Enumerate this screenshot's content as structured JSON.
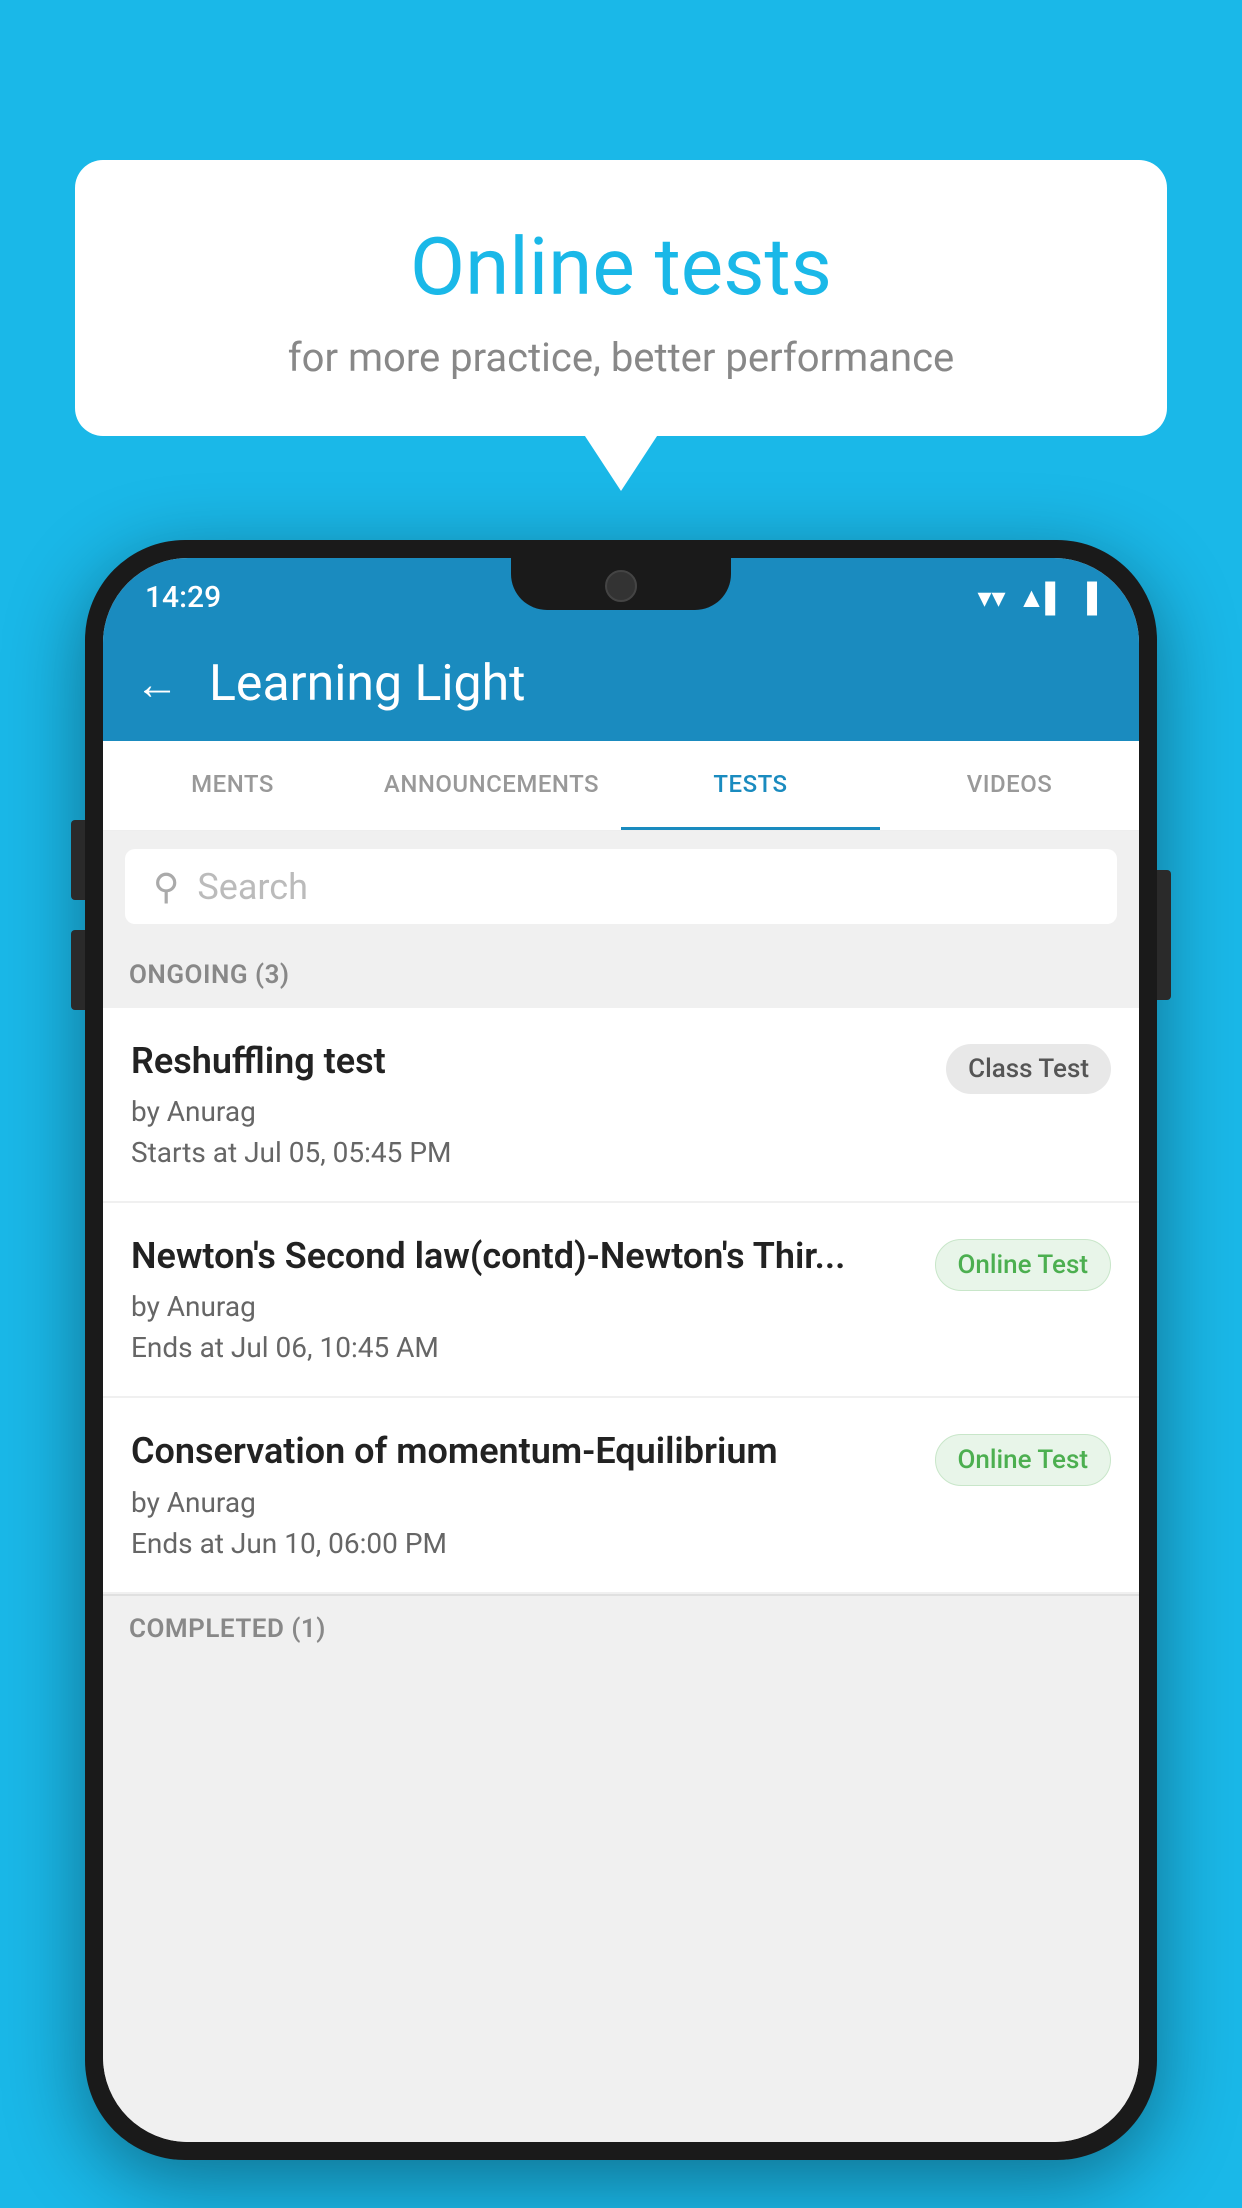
{
  "background": {
    "color": "#1ab8e8"
  },
  "speech_bubble": {
    "title": "Online tests",
    "subtitle": "for more practice, better performance"
  },
  "phone": {
    "status_bar": {
      "time": "14:29",
      "wifi": "▼",
      "signal": "▲",
      "battery": "▐"
    },
    "app_bar": {
      "back_label": "←",
      "title": "Learning Light"
    },
    "tabs": [
      {
        "label": "MENTS",
        "active": false
      },
      {
        "label": "ANNOUNCEMENTS",
        "active": false
      },
      {
        "label": "TESTS",
        "active": true
      },
      {
        "label": "VIDEOS",
        "active": false
      }
    ],
    "search": {
      "placeholder": "Search"
    },
    "ongoing_section": {
      "header": "ONGOING (3)"
    },
    "tests": [
      {
        "title": "Reshuffling test",
        "author": "by Anurag",
        "time_label": "Starts at",
        "time": "Jul 05, 05:45 PM",
        "badge": "Class Test",
        "badge_type": "class"
      },
      {
        "title": "Newton's Second law(contd)-Newton's Thir...",
        "author": "by Anurag",
        "time_label": "Ends at",
        "time": "Jul 06, 10:45 AM",
        "badge": "Online Test",
        "badge_type": "online"
      },
      {
        "title": "Conservation of momentum-Equilibrium",
        "author": "by Anurag",
        "time_label": "Ends at",
        "time": "Jun 10, 06:00 PM",
        "badge": "Online Test",
        "badge_type": "online"
      }
    ],
    "completed_section": {
      "header": "COMPLETED (1)"
    }
  }
}
